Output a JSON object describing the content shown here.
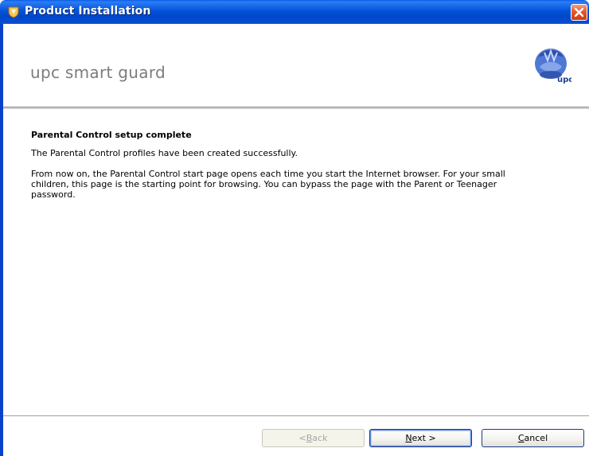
{
  "window": {
    "title": "Product Installation",
    "icon": "shield-icon",
    "close_icon": "close-icon"
  },
  "header": {
    "brand": "upc smart guard",
    "logo_text": "upc",
    "logo_icon": "upc-logo-icon"
  },
  "content": {
    "heading": "Parental Control setup complete",
    "paragraph_1": "The Parental Control profiles have been created successfully.",
    "paragraph_2": "From now on, the Parental Control start page opens each time you start the Internet browser. For your small children, this page is the starting point for browsing. You can bypass the page with the Parent or Teenager password."
  },
  "buttons": {
    "back": {
      "prefix": "< ",
      "mnemonic": "B",
      "rest": "ack",
      "enabled": false
    },
    "next": {
      "mnemonic": "N",
      "rest": "ext >",
      "enabled": true
    },
    "cancel": {
      "mnemonic": "C",
      "rest": "ancel",
      "enabled": true
    }
  },
  "colors": {
    "titlebar": "#0553d8",
    "close_button": "#e2582f",
    "brand_text": "#7c7c7c",
    "logo_blue": "#3b63c4"
  }
}
